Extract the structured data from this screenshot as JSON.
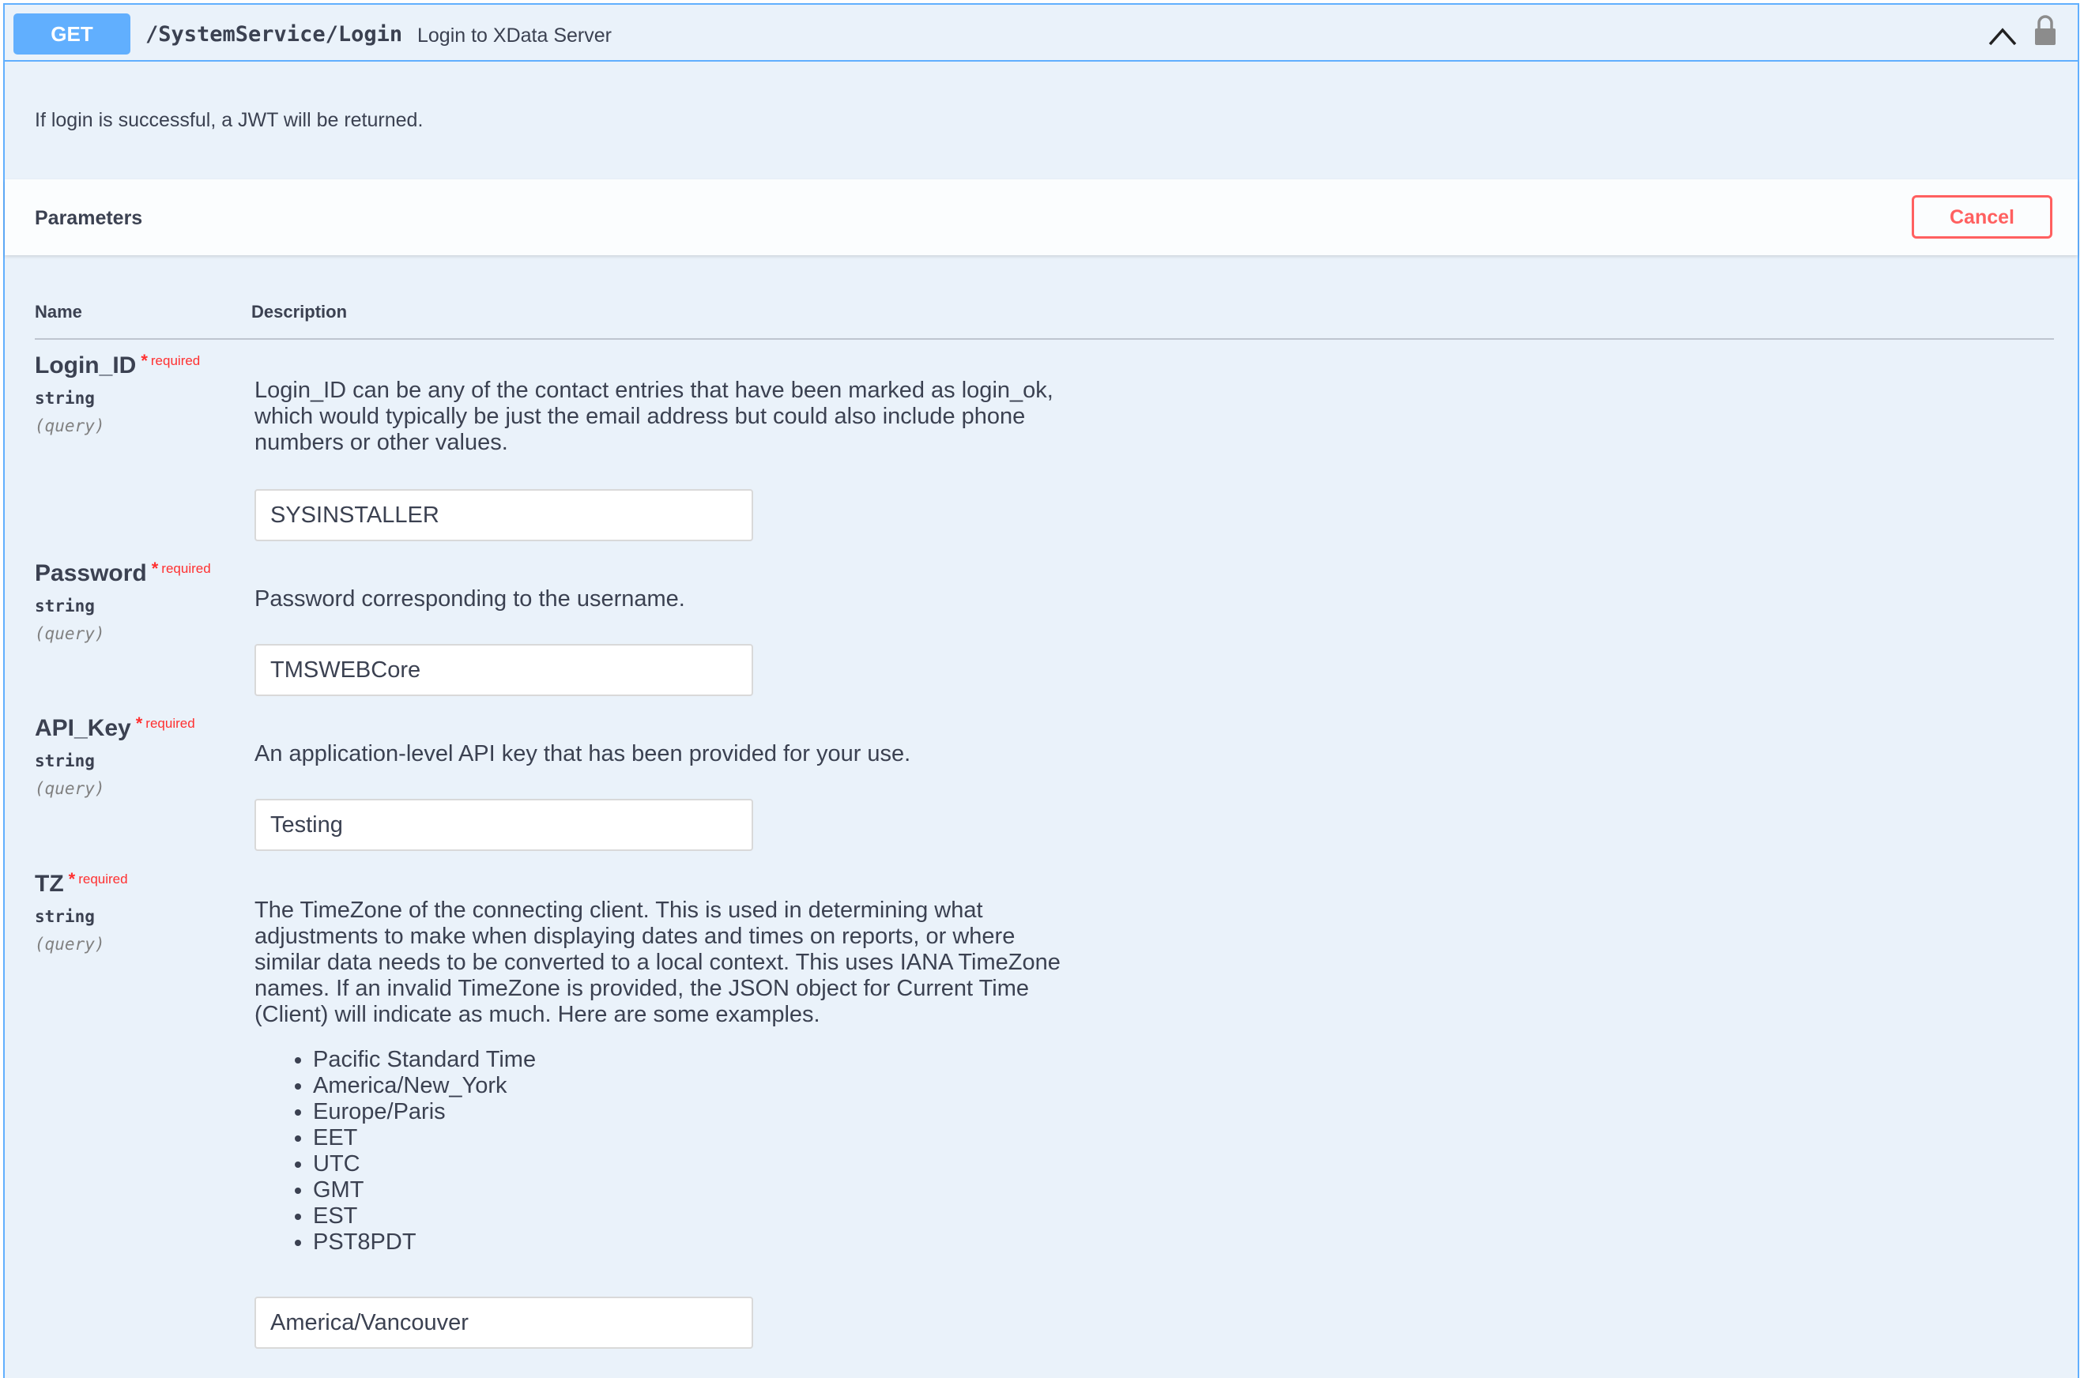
{
  "operation": {
    "method": "GET",
    "path": "/SystemService/Login",
    "summary": "Login to XData Server",
    "description": "If login is successful, a JWT will be returned.",
    "icons": {
      "collapse": "chevron-up-icon",
      "auth": "lock-icon"
    }
  },
  "parameters_section": {
    "title": "Parameters",
    "cancel_label": "Cancel",
    "col_name": "Name",
    "col_description": "Description"
  },
  "params": [
    {
      "name": "Login_ID",
      "star": "*",
      "required_label": "required",
      "type": "string",
      "in": "(query)",
      "description": "Login_ID can be any of the contact entries that have been marked as login_ok, which would typically be just the email address but could also include phone numbers or other values.",
      "value": "SYSINSTALLER"
    },
    {
      "name": "Password",
      "star": "*",
      "required_label": "required",
      "type": "string",
      "in": "(query)",
      "description": "Password corresponding to the username.",
      "value": "TMSWEBCore"
    },
    {
      "name": "API_Key",
      "star": "*",
      "required_label": "required",
      "type": "string",
      "in": "(query)",
      "description": "An application-level API key that has been provided for your use.",
      "value": "Testing"
    },
    {
      "name": "TZ",
      "star": "*",
      "required_label": "required",
      "type": "string",
      "in": "(query)",
      "description": "The TimeZone of the connecting client. This is used in determining what adjustments to make when displaying dates and times on reports, or where similar data needs to be converted to a local context. This uses IANA TimeZone names. If an invalid TimeZone is provided, the JSON object for Current Time (Client) will indicate as much. Here are some examples.",
      "examples": [
        "Pacific Standard Time",
        "America/New_York",
        "Europe/Paris",
        "EET",
        "UTC",
        "GMT",
        "EST",
        "PST8PDT"
      ],
      "value": "America/Vancouver"
    }
  ],
  "colors": {
    "get_method": "#61affe",
    "required": "#ff3030",
    "cancel": "#ff6060",
    "block_background": "#eaf2fa"
  }
}
